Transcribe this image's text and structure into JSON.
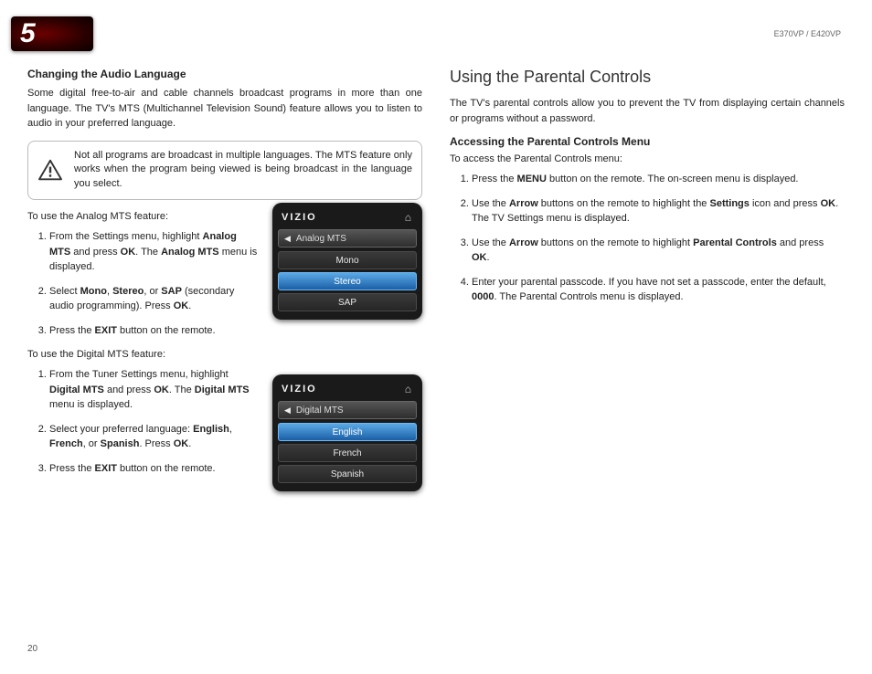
{
  "chapter_number": "5",
  "model_header": "E370VP / E420VP",
  "page_number": "20",
  "left": {
    "heading": "Changing the Audio Language",
    "intro": "Some digital free-to-air and cable channels broadcast programs in more than one language. The TV's MTS (Multichannel Television Sound) feature allows you to listen to audio in your preferred language.",
    "note": "Not all programs are broadcast in multiple languages. The MTS feature only works when the program being viewed is being broadcast in the language you select.",
    "analog_intro": "To use the Analog MTS feature:",
    "analog_steps": {
      "s1_a": "From the Settings menu, highlight ",
      "s1_b1": "Analog MTS",
      "s1_c": " and press ",
      "s1_b2": "OK",
      "s1_d": ". The ",
      "s1_b3": "Analog MTS",
      "s1_e": " menu is displayed.",
      "s2_a": "Select ",
      "s2_b1": "Mono",
      "s2_c": ", ",
      "s2_b2": "Stereo",
      "s2_d": ", or ",
      "s2_b3": "SAP",
      "s2_e": " (secondary audio programming). Press ",
      "s2_b4": "OK",
      "s2_f": ".",
      "s3_a": "Press the ",
      "s3_b1": "EXIT",
      "s3_c": " button on the remote."
    },
    "digital_intro": "To use the Digital MTS feature:",
    "digital_steps": {
      "s1_a": "From the Tuner Settings menu, highlight ",
      "s1_b1": "Digital MTS",
      "s1_c": " and press ",
      "s1_b2": "OK",
      "s1_d": ". The ",
      "s1_b3": "Digital MTS",
      "s1_e": " menu is displayed.",
      "s2_a": "Select your preferred language: ",
      "s2_b1": "English",
      "s2_c": ", ",
      "s2_b2": "French",
      "s2_d": ", or ",
      "s2_b3": "Spanish",
      "s2_e": ". Press ",
      "s2_b4": "OK",
      "s2_f": ".",
      "s3_a": "Press the ",
      "s3_b1": "EXIT",
      "s3_c": " button on the remote."
    },
    "menu1": {
      "logo": "VIZIO",
      "sub": "Analog MTS",
      "items": [
        "Mono",
        "Stereo",
        "SAP"
      ],
      "selected_index": 1
    },
    "menu2": {
      "logo": "VIZIO",
      "sub": "Digital MTS",
      "items": [
        "English",
        "French",
        "Spanish"
      ],
      "selected_index": 0
    }
  },
  "right": {
    "title": "Using the Parental Controls",
    "intro": "The TV's parental controls allow you to prevent the TV from displaying certain channels or programs without a password.",
    "heading": "Accessing the Parental Controls Menu",
    "access_line": "To access the Parental Controls menu:",
    "steps": {
      "s1_a": "Press the ",
      "s1_b1": "MENU",
      "s1_c": " button on the remote. The on-screen menu is displayed.",
      "s2_a": "Use the ",
      "s2_b1": "Arrow",
      "s2_c": " buttons on the remote to highlight the ",
      "s2_b2": "Settings",
      "s2_d": " icon and press ",
      "s2_b3": "OK",
      "s2_e": ". The TV Settings menu is displayed.",
      "s3_a": "Use the ",
      "s3_b1": "Arrow",
      "s3_c": " buttons on the remote to highlight ",
      "s3_b2": "Parental Controls",
      "s3_d": " and press ",
      "s3_b3": "OK",
      "s3_e": ".",
      "s4_a": "Enter your parental passcode. If you have not set a passcode, enter the default, ",
      "s4_b1": "0000",
      "s4_c": ". The Parental Controls menu is displayed."
    }
  }
}
